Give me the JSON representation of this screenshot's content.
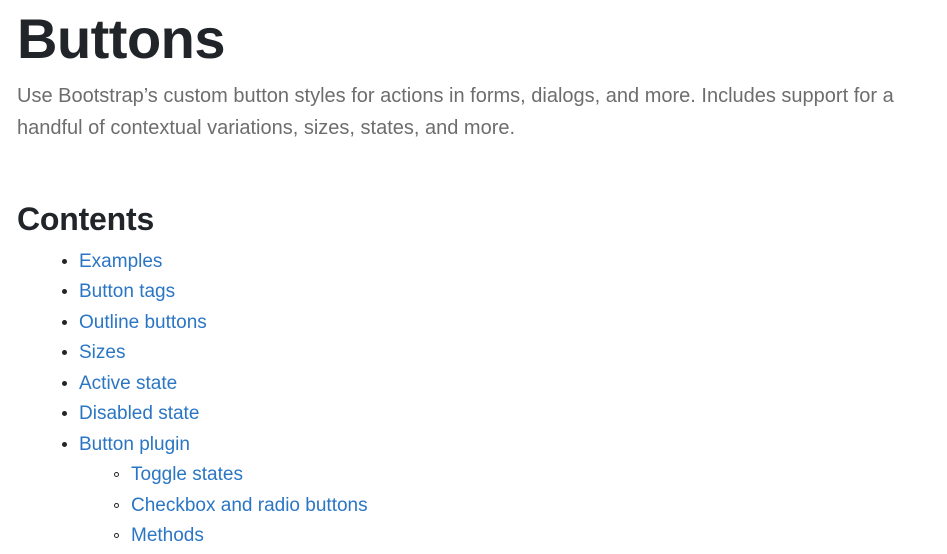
{
  "page": {
    "title": "Buttons",
    "lead": "Use Bootstrap’s custom button styles for actions in forms, dialogs, and more. Includes support for a handful of contextual variations, sizes, states, and more."
  },
  "contents": {
    "heading": "Contents",
    "items": [
      {
        "label": "Examples"
      },
      {
        "label": "Button tags"
      },
      {
        "label": "Outline buttons"
      },
      {
        "label": "Sizes"
      },
      {
        "label": "Active state"
      },
      {
        "label": "Disabled state"
      },
      {
        "label": "Button plugin",
        "children": [
          {
            "label": "Toggle states"
          },
          {
            "label": "Checkbox and radio buttons"
          },
          {
            "label": "Methods"
          }
        ]
      }
    ]
  },
  "colors": {
    "link": "#2b76c4",
    "heading": "#212529",
    "lead_text": "#6d6d6d",
    "background": "#ffffff"
  }
}
